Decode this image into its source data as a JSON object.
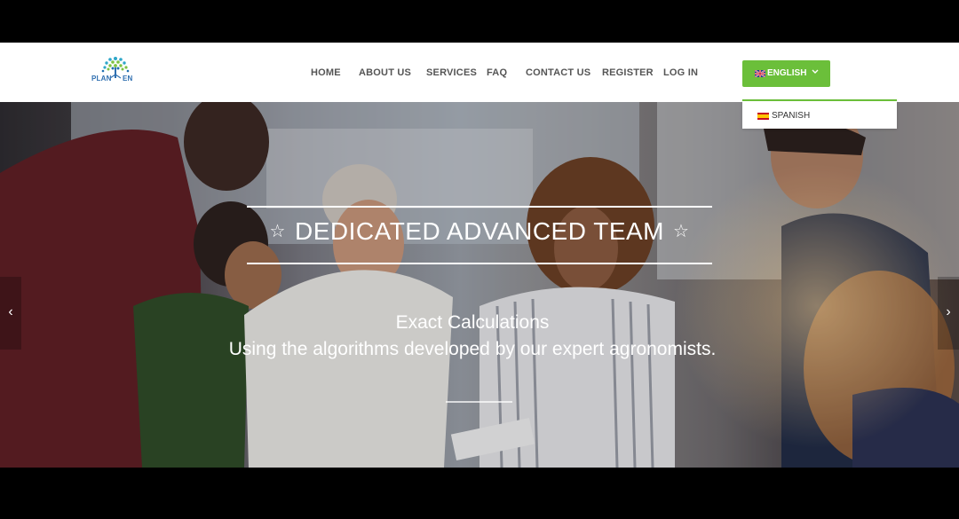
{
  "logo": {
    "text_left": "PLAN",
    "text_right": "EN",
    "icon": "tree-logo-icon"
  },
  "nav": {
    "items": [
      {
        "label": "HOME"
      },
      {
        "label": "ABOUT US"
      },
      {
        "label": "SERVICES"
      },
      {
        "label": "FAQ"
      },
      {
        "label": "CONTACT US"
      },
      {
        "label": "REGISTER"
      },
      {
        "label": "LOG IN"
      }
    ]
  },
  "language": {
    "selected": "ENGLISH",
    "selected_flag": "uk-flag-icon",
    "options": [
      {
        "label": "SPANISH",
        "flag": "spain-flag-icon"
      }
    ]
  },
  "hero": {
    "title": "DEDICATED ADVANCED TEAM",
    "star_icon": "☆",
    "subtitle_line1": "Exact Calculations",
    "subtitle_line2": "Using the algorithms developed by our expert agronomists.",
    "prev_icon": "‹",
    "next_icon": "›"
  },
  "colors": {
    "accent": "#6bbf3a",
    "nav_text": "#555555",
    "header_bg": "#ffffff"
  }
}
